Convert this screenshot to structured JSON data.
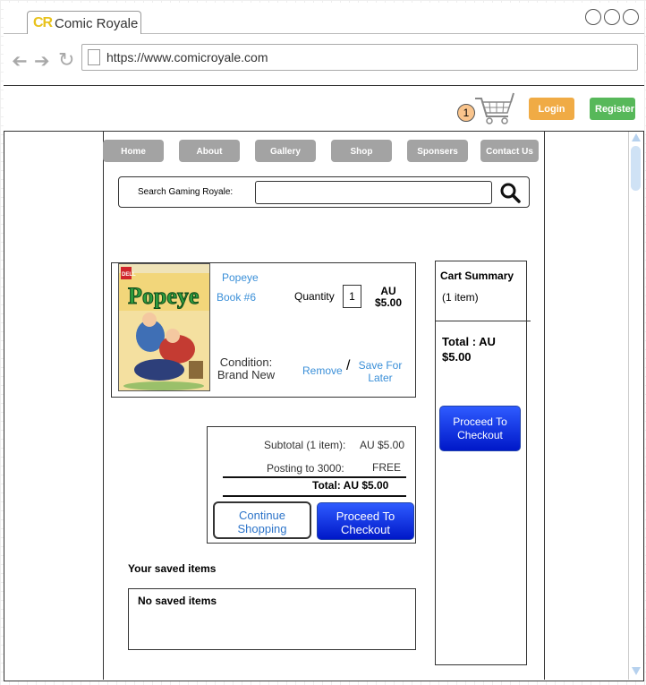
{
  "browser": {
    "tab_logo": "CR",
    "tab_title": "Comic Royale",
    "url": "https://www.comicroyale.com"
  },
  "header": {
    "cart_count": "1",
    "login_label": "Login",
    "register_label": "Register"
  },
  "menu": [
    {
      "label": "Home"
    },
    {
      "label": "About"
    },
    {
      "label": "Gallery"
    },
    {
      "label": "Shop"
    },
    {
      "label": "Sponsers"
    },
    {
      "label": "Contact Us"
    }
  ],
  "search": {
    "label": "Search Gaming Royale:",
    "value": ""
  },
  "product": {
    "name": "Popeye",
    "subtitle": "Book #6",
    "quantity_label": "Quantity",
    "quantity": "1",
    "price_currency": "AU",
    "price": "$5.00",
    "condition_label": "Condition:",
    "condition": "Brand New",
    "remove_label": "Remove",
    "separator": "/",
    "save_later_label": "Save For Later",
    "cover_title": "Popeye",
    "cover_brand": "DELL"
  },
  "totals": {
    "subtotal_label": "Subtotal (1 item):",
    "subtotal_value": "AU $5.00",
    "posting_label": "Posting to 3000:",
    "posting_value": "FREE",
    "total_label": "Total: AU $5.00",
    "continue_label": "Continue Shopping",
    "checkout_label": "Proceed To Checkout"
  },
  "saved": {
    "title": "Your saved items",
    "empty_text": "No saved items"
  },
  "cart_summary": {
    "title": "Cart Summary",
    "count": "(1 item)",
    "total_line1": "Total : AU",
    "total_line2": "$5.00",
    "checkout_label": "Proceed To Checkout"
  },
  "colors": {
    "login": "#f0ab45",
    "register": "#57b85a",
    "menu": "#a3a3a3",
    "link": "#3a8fd8",
    "checkout": "#0a2ee6"
  }
}
